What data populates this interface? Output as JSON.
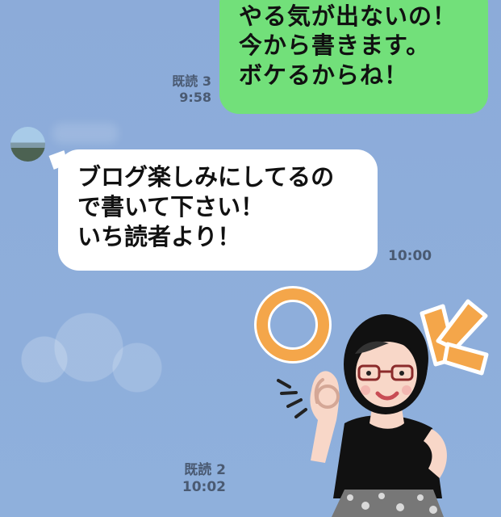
{
  "messages": {
    "outgoing": {
      "text": "やる気が出ないの！\n今から書きます。\nボケるからね！",
      "read_status": "既読 3",
      "time": "9:58"
    },
    "incoming": {
      "sender_name": "",
      "text": "ブログ楽しみにしてるの\nで書いて下さい！\nいち読者より！",
      "time": "10:00"
    },
    "sticker": {
      "read_status": "既読 2",
      "time": "10:02"
    }
  }
}
